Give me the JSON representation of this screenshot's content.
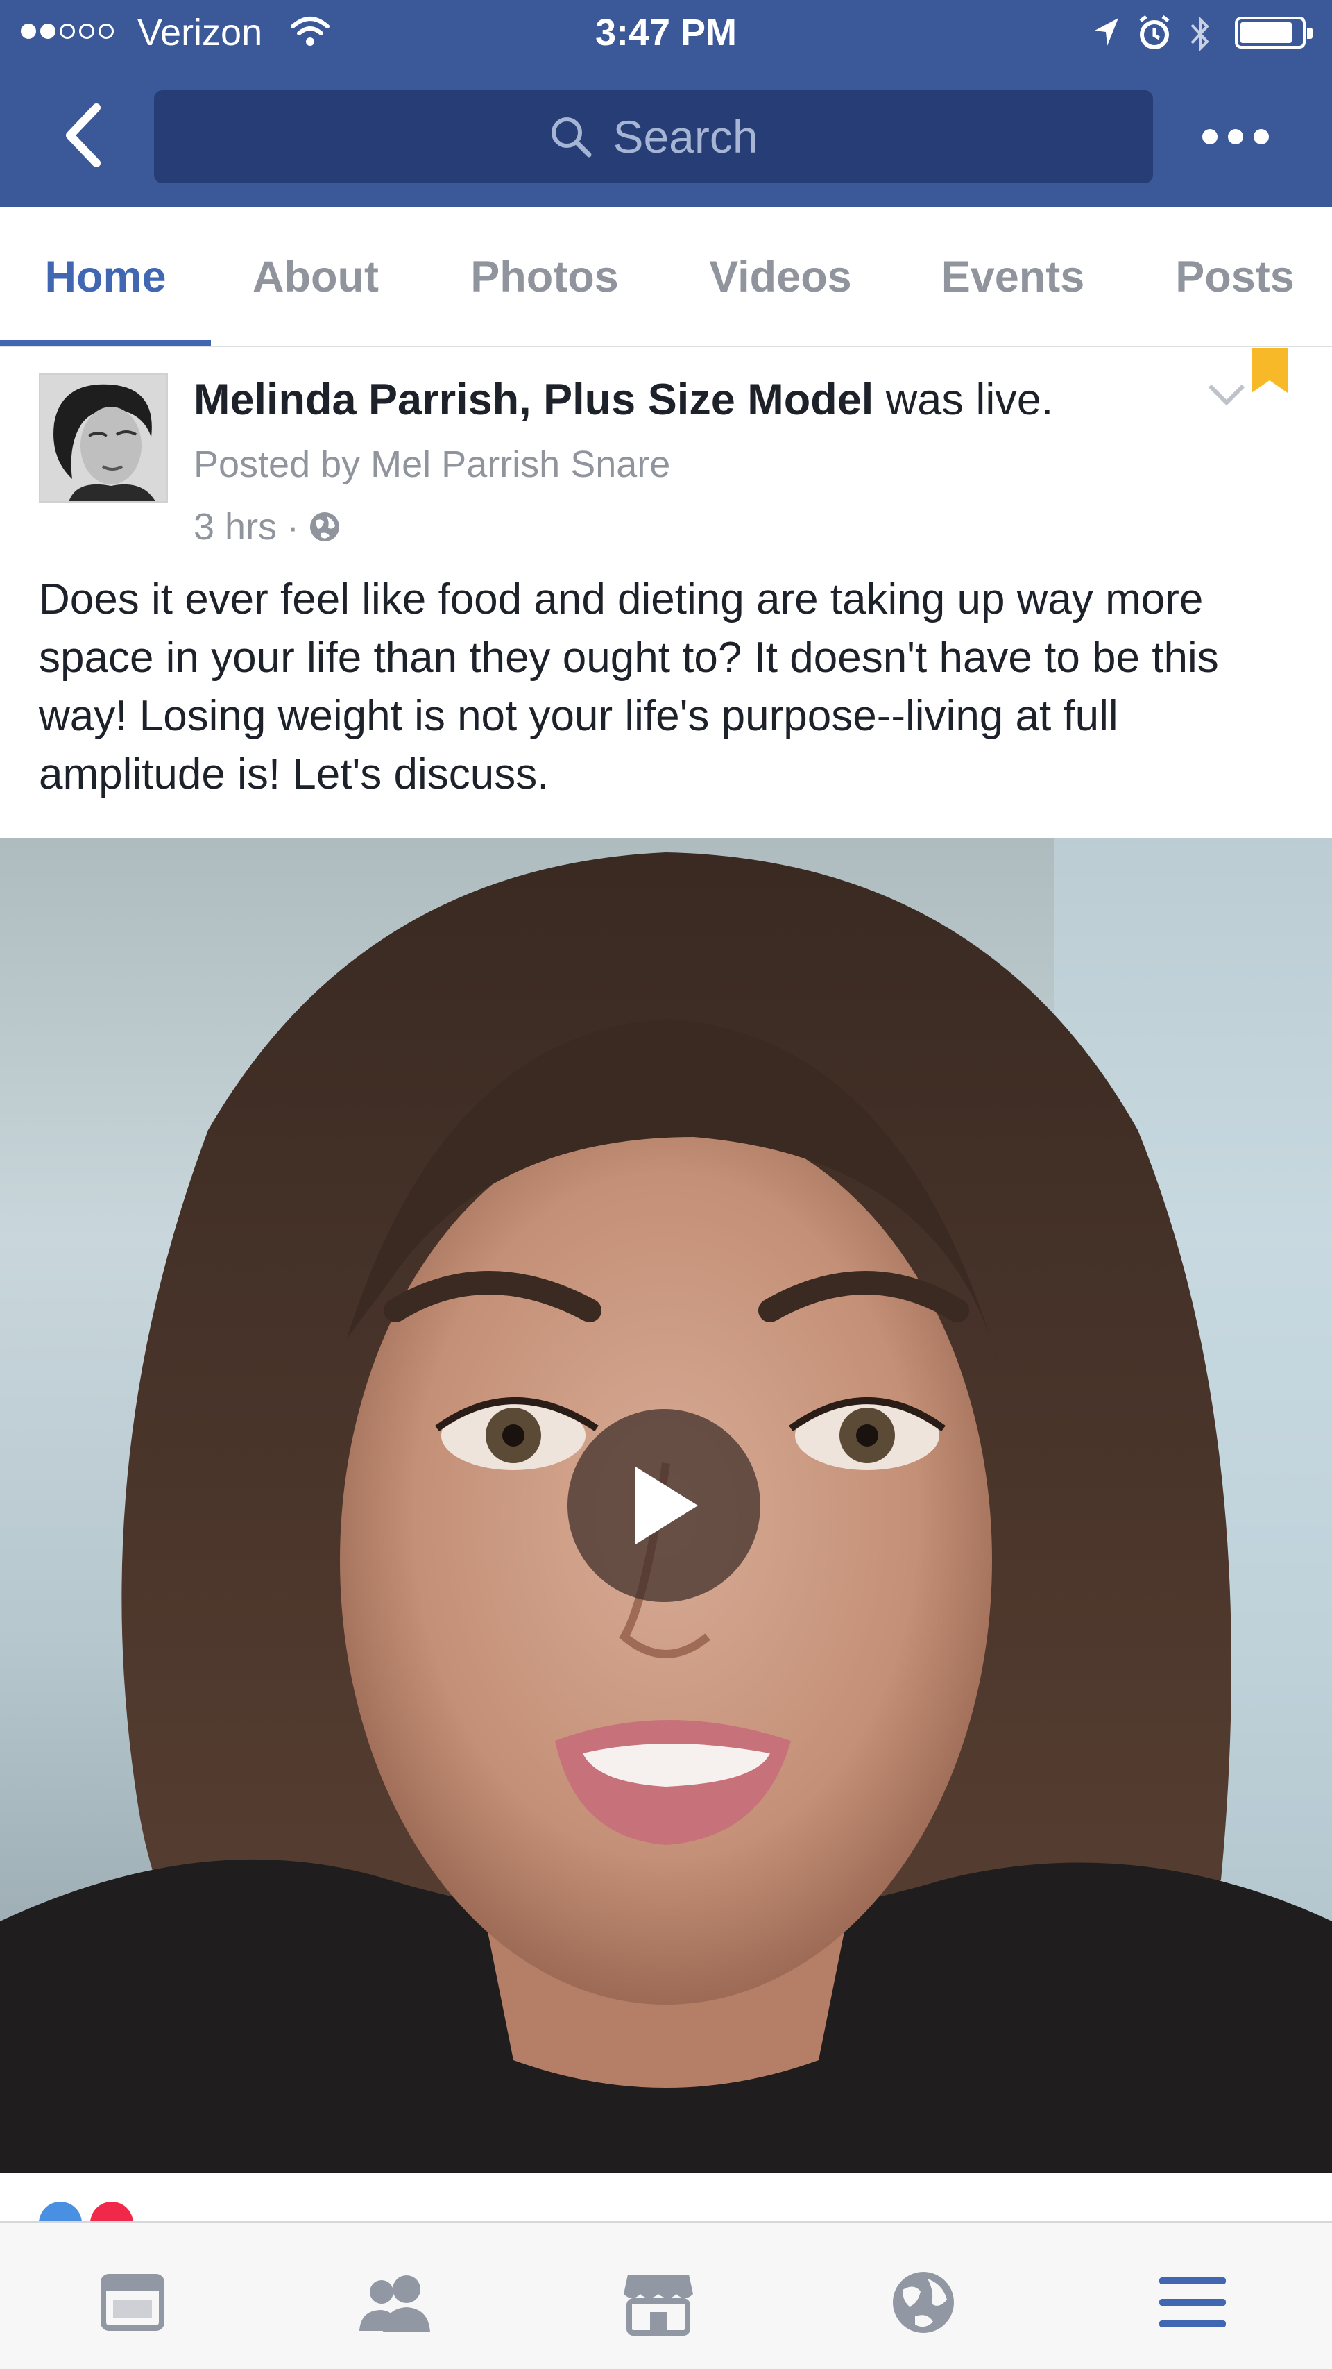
{
  "status_bar": {
    "carrier": "Verizon",
    "time": "3:47 PM",
    "signal_bars_filled": 2,
    "signal_bars_total": 5,
    "icons": [
      "wifi-icon",
      "location-arrow-icon",
      "alarm-icon",
      "bluetooth-icon",
      "battery-icon"
    ]
  },
  "nav": {
    "back_icon": "back-chevron-icon",
    "search_placeholder": "Search",
    "more_icon": "more-dots-icon"
  },
  "tabs": [
    {
      "label": "Home",
      "active": true
    },
    {
      "label": "About",
      "active": false
    },
    {
      "label": "Photos",
      "active": false
    },
    {
      "label": "Videos",
      "active": false
    },
    {
      "label": "Events",
      "active": false
    },
    {
      "label": "Posts",
      "active": false
    }
  ],
  "post": {
    "author": "Melinda Parrish, Plus Size Model",
    "action": "was live.",
    "posted_by": "Posted by Mel Parrish Snare",
    "time": "3 hrs",
    "separator": "·",
    "audience_icon": "globe-icon",
    "text": "Does it ever feel like food and dieting are taking up way more space in your life than they ought to? It doesn't have to be this way! Losing weight is not your life's purpose--living at full amplitude is! Let's discuss.",
    "video": {
      "play_icon": "play-icon"
    }
  },
  "tabbar": {
    "items": [
      "news-feed-icon",
      "friends-icon",
      "marketplace-icon",
      "globe-icon",
      "menu-icon"
    ],
    "active_color": "#4267b2",
    "inactive_color": "#9197a3"
  },
  "colors": {
    "brand_blue": "#3b5998",
    "search_bg": "#263e75",
    "link_blue": "#4267b2",
    "secondary_text": "#90949c"
  }
}
